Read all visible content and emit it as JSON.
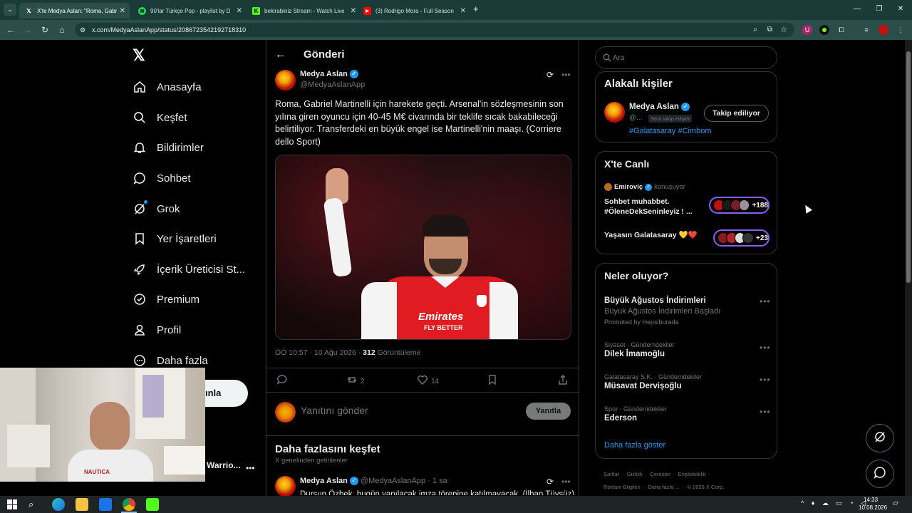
{
  "browser": {
    "tabs": [
      {
        "title": "X'te Medya Aslan: \"Roma, Gabri",
        "active": true,
        "icon": "x-logo-icon"
      },
      {
        "title": "90'lar Türkçe Pop - playlist by D",
        "active": false,
        "icon": "spotify-icon"
      },
      {
        "title": "bekirabiniz Stream - Watch Live",
        "active": false,
        "icon": "kick-icon"
      },
      {
        "title": "(3) Rodrigo Mora - Full Season",
        "active": false,
        "icon": "youtube-icon"
      }
    ],
    "url": "x.com/MedyaAslanApp/status/2086723542192718310"
  },
  "sidebar": {
    "items": [
      {
        "label": "Anasayfa",
        "icon": "home-icon"
      },
      {
        "label": "Keşfet",
        "icon": "search-icon"
      },
      {
        "label": "Bildirimler",
        "icon": "bell-icon"
      },
      {
        "label": "Sohbet",
        "icon": "chat-icon"
      },
      {
        "label": "Grok",
        "icon": "grok-icon"
      },
      {
        "label": "Yer İşaretleri",
        "icon": "bookmark-icon"
      },
      {
        "label": "İçerik Üreticisi St...",
        "icon": "rocket-icon"
      },
      {
        "label": "Premium",
        "icon": "premium-icon"
      },
      {
        "label": "Profil",
        "icon": "person-icon"
      },
      {
        "label": "Daha fazla",
        "icon": "more-circle-icon"
      }
    ],
    "post_button_partial": "ınla",
    "account_partial": "Warrio..."
  },
  "post": {
    "header_title": "Gönderi",
    "author_name": "Medya Aslan",
    "author_handle": "@MedyaAslanApp",
    "text": "Roma, Gabriel Martinelli için harekete geçti. Arsenal'in sözleşmesinin son yılına giren oyuncu için 40-45 M€ civarında bir teklife sıcak bakabileceği belirtiliyor. Transferdeki en büyük engel ise Martinelli'nin maaşı. (Corriere dello Sport)",
    "meta_time": "ÖÖ 10:57 · 10 Ağu 2026 · ",
    "views_count": "312",
    "views_label": " Görüntüleme",
    "retweets": "2",
    "likes": "14",
    "reply_placeholder": "Yanıtını gönder",
    "reply_button": "Yanıtla",
    "image_text": {
      "sponsor_top": "Emirates",
      "sponsor_bottom": "FLY BETTER"
    }
  },
  "discover": {
    "title": "Daha fazlasını keşfet",
    "subtitle": "X genelinden getirilenler",
    "next_author": "Medya Aslan",
    "next_handle": "@MedyaAslanApp · 1 sa",
    "next_text": "Dursun Özbek, bugün yapılacak imza törenine katılmayacak. (İlhan Tüysüz)"
  },
  "right": {
    "search_placeholder": "Ara",
    "related_title": "Alakalı kişiler",
    "related_name": "Medya Aslan",
    "related_handle": "@...",
    "follows_you": "Seni takip ediyor",
    "following_button": "Takip ediliyor",
    "related_tags": "#Galatasaray #Cimbom",
    "live_title": "X'te Canlı",
    "live_host": "Emiroviç",
    "live_status": "konuşuyor",
    "live_space1": "Sohbet muhabbet. #ÖleneDekSeninleyiz ! ...",
    "live_space1_count": "+188",
    "live_space2": "Yaşasın Galatasaray 💛❤️",
    "live_space2_count": "+23",
    "trends_title": "Neler oluyor?",
    "trends": [
      {
        "category": "",
        "title": "Büyük Ağustos İndirimleri",
        "sub": "Büyük Ağustos İndirimleri Başladı",
        "promo": "Promoted by Hepsiburada"
      },
      {
        "category": "Siyaset · Gündemdekiler",
        "title": "Dilek İmamoğlu",
        "sub": "",
        "promo": ""
      },
      {
        "category": "Galatasaray S.K. · Gündemdekiler",
        "title": "Müsavat Dervişoğlu",
        "sub": "",
        "promo": ""
      },
      {
        "category": "Spor · Gündemdekiler",
        "title": "Ederson",
        "sub": "",
        "promo": ""
      }
    ],
    "show_more": "Daha fazla göster",
    "footer_line1": "Şartlar  ·  Gizlilik  ·  Çerezler  ·  Erişilebilirlik  ·",
    "footer_line2": "Reklam Bilgileri  ·  Daha fazla ...  ·  © 2026 X Corp."
  },
  "taskbar": {
    "time": "14:33",
    "date": "10.08.2026"
  },
  "colors": {
    "accent": "#1d9bf0",
    "tab_bg": "#1b3b38",
    "addr_bg": "#2c4e4a",
    "live_pill": "#8b5cf6"
  }
}
